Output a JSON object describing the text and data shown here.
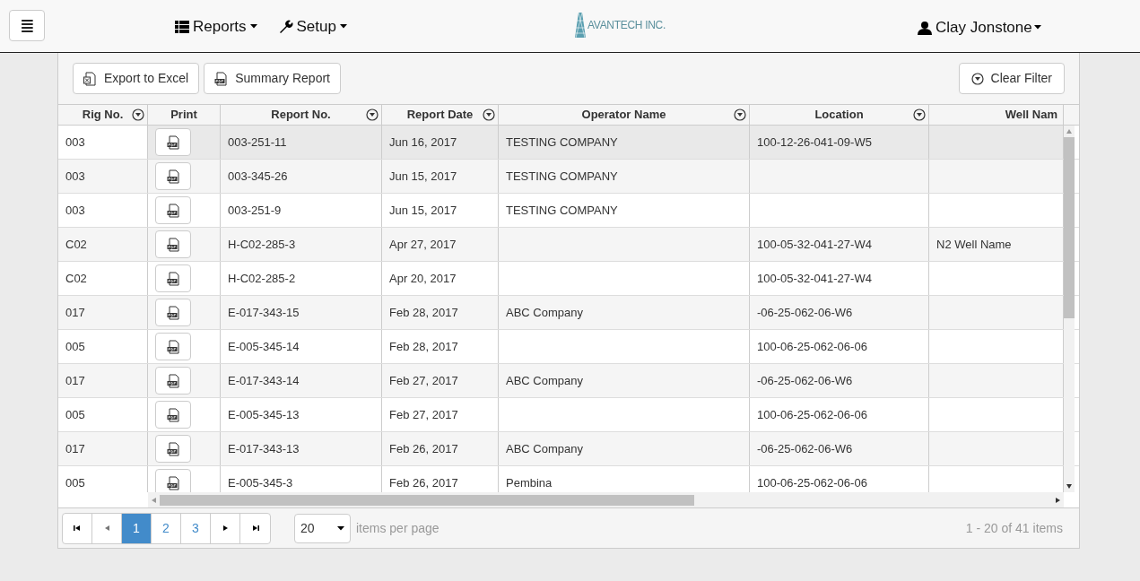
{
  "navbar": {
    "menu_button": "≣",
    "menus": [
      {
        "label": "Reports"
      },
      {
        "label": "Setup"
      }
    ],
    "logo": "AVANTECH INC.",
    "user": "Clay Jonstone"
  },
  "toolbar": {
    "buttons": [
      {
        "label": "Export to Excel"
      },
      {
        "label": "Summary Report"
      }
    ],
    "clear_filter": "Clear Filter"
  },
  "table": {
    "columns": [
      {
        "label": "Rig No.",
        "filter": true
      },
      {
        "label": "Print",
        "filter": false
      },
      {
        "label": "Report No.",
        "filter": true
      },
      {
        "label": "Report Date",
        "filter": true
      },
      {
        "label": "Operator Name",
        "filter": true
      },
      {
        "label": "Location",
        "filter": true
      },
      {
        "label": "Well Nam",
        "filter": false
      }
    ],
    "rows": [
      {
        "selected": true,
        "cells": [
          "003",
          "",
          "003-251-11",
          "Jun 16, 2017",
          "TESTING COMPANY",
          "100-12-26-041-09-W5",
          ""
        ]
      },
      {
        "selected": false,
        "cells": [
          "003",
          "",
          "003-345-26",
          "Jun 15, 2017",
          "TESTING COMPANY",
          "",
          ""
        ]
      },
      {
        "selected": false,
        "cells": [
          "003",
          "",
          "003-251-9",
          "Jun 15, 2017",
          "TESTING COMPANY",
          "",
          ""
        ]
      },
      {
        "selected": false,
        "cells": [
          "C02",
          "",
          "H-C02-285-3",
          "Apr 27, 2017",
          "",
          "100-05-32-041-27-W4",
          "N2 Well Name"
        ]
      },
      {
        "selected": false,
        "cells": [
          "C02",
          "",
          "H-C02-285-2",
          "Apr 20, 2017",
          "",
          "100-05-32-041-27-W4",
          ""
        ]
      },
      {
        "selected": false,
        "cells": [
          "017",
          "",
          "E-017-343-15",
          "Feb 28, 2017",
          "ABC Company",
          "-06-25-062-06-W6",
          ""
        ]
      },
      {
        "selected": false,
        "cells": [
          "005",
          "",
          "E-005-345-14",
          "Feb 28, 2017",
          "",
          "100-06-25-062-06-06",
          ""
        ]
      },
      {
        "selected": false,
        "cells": [
          "017",
          "",
          "E-017-343-14",
          "Feb 27, 2017",
          "ABC Company",
          "-06-25-062-06-W6",
          ""
        ]
      },
      {
        "selected": false,
        "cells": [
          "005",
          "",
          "E-005-345-13",
          "Feb 27, 2017",
          "",
          "100-06-25-062-06-06",
          ""
        ]
      },
      {
        "selected": false,
        "cells": [
          "017",
          "",
          "E-017-343-13",
          "Feb 26, 2017",
          "ABC Company",
          "-06-25-062-06-W6",
          ""
        ]
      },
      {
        "selected": false,
        "cells": [
          "005",
          "",
          "E-005-345-3",
          "Feb 26, 2017",
          "Pembina",
          "100-06-25-062-06-06",
          ""
        ]
      }
    ]
  },
  "pager": {
    "pages": [
      {
        "label": "1",
        "selected": true
      },
      {
        "label": "2",
        "selected": false
      },
      {
        "label": "3",
        "selected": false
      }
    ],
    "page_size": "20",
    "page_size_label": "items per page",
    "summary": "1 - 20 of 41 items"
  }
}
